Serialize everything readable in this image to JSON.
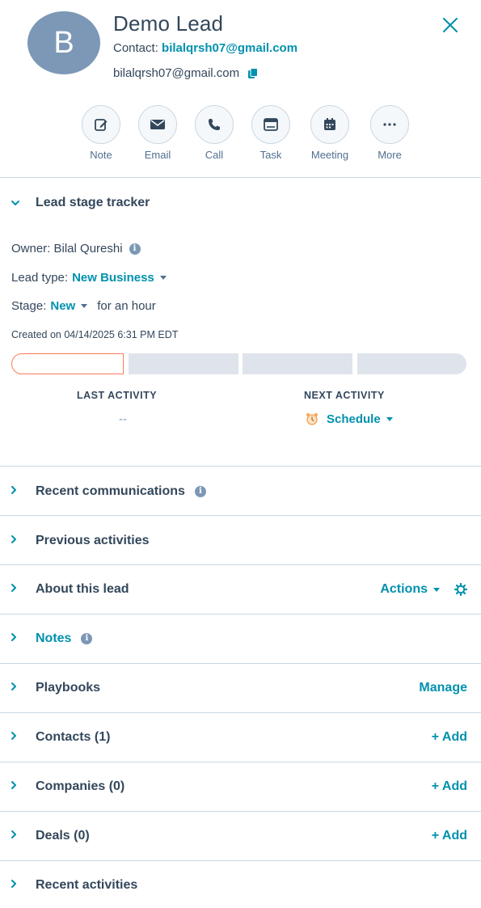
{
  "header": {
    "avatar_initial": "B",
    "title": "Demo Lead",
    "contact_label": "Contact:",
    "contact_value": "bilalqrsh07@gmail.com",
    "email": "bilalqrsh07@gmail.com"
  },
  "actions": [
    {
      "label": "Note",
      "icon": "edit-icon"
    },
    {
      "label": "Email",
      "icon": "envelope-icon"
    },
    {
      "label": "Call",
      "icon": "phone-icon"
    },
    {
      "label": "Task",
      "icon": "task-icon"
    },
    {
      "label": "Meeting",
      "icon": "calendar-icon"
    },
    {
      "label": "More",
      "icon": "more-icon"
    }
  ],
  "tracker": {
    "title": "Lead stage tracker",
    "owner": "Owner: Bilal Qureshi",
    "lead_type_label": "Lead type:",
    "lead_type_value": "New Business",
    "stage_label": "Stage:",
    "stage_value": "New",
    "stage_duration": "for an hour",
    "created": "Created on 04/14/2025 6:31 PM EDT",
    "stage_segments": 4,
    "current_segment": 1,
    "last_activity_label": "LAST ACTIVITY",
    "last_activity_value": "--",
    "next_activity_label": "NEXT ACTIVITY",
    "next_activity_value": "Schedule"
  },
  "sections": [
    {
      "title": "Recent communications",
      "info": true,
      "right": ""
    },
    {
      "title": "Previous activities",
      "info": false,
      "right": ""
    },
    {
      "title": "About this lead",
      "info": false,
      "right": "Actions"
    },
    {
      "title": "Notes",
      "info": true,
      "right": ""
    },
    {
      "title": "Playbooks",
      "info": false,
      "right": "Manage"
    },
    {
      "title": "Contacts (1)",
      "info": false,
      "right": "+ Add"
    },
    {
      "title": "Companies (0)",
      "info": false,
      "right": "+ Add"
    },
    {
      "title": "Deals (0)",
      "info": false,
      "right": "+ Add"
    },
    {
      "title": "Recent activities",
      "info": false,
      "right": ""
    }
  ],
  "colors": {
    "accent": "#0091ae",
    "text": "#33475b",
    "avatar": "#7c98b6",
    "current_stage_border": "#ff7a59",
    "stage_inactive": "#dfe3eb",
    "divider": "#cbd6e2"
  }
}
